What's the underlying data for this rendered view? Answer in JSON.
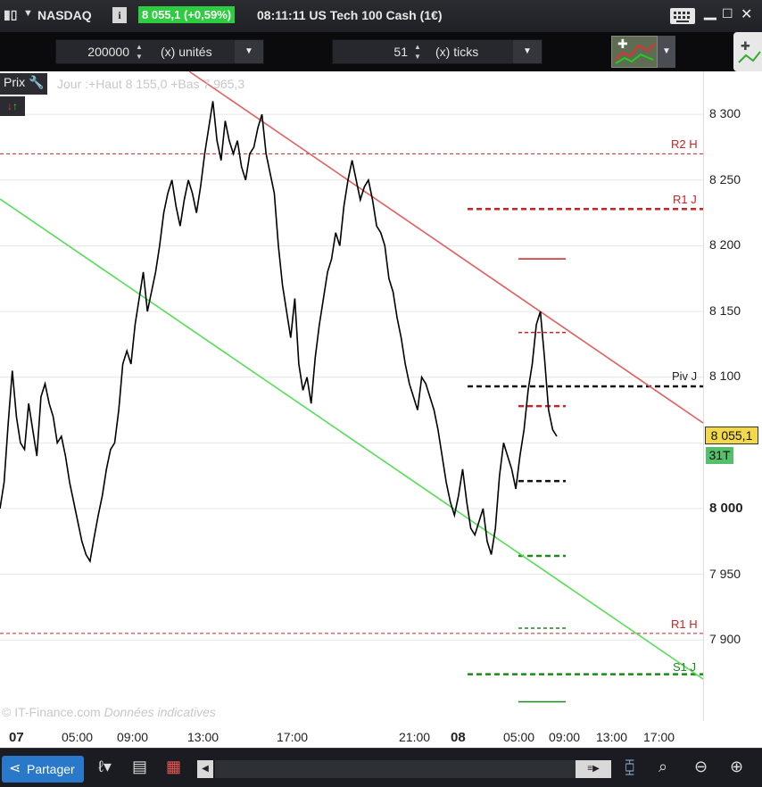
{
  "titlebar": {
    "symbol": "NASDAQ",
    "info_icon_label": "i",
    "quote": "8 055,1 (+0,59%)",
    "time_instrument": "08:11:11 US Tech 100 Cash (1€)",
    "icons": [
      "candlestick-icon",
      "chevron-down-icon",
      "keyboard-icon",
      "minimize-icon",
      "maximize-icon",
      "close-icon"
    ]
  },
  "toolbar": {
    "quantity_value": "200000",
    "quantity_unit": "(x) unités",
    "ticks_value": "51",
    "ticks_unit": "(x) ticks"
  },
  "legend": {
    "price_label": "Prix",
    "arrows": "↓↑",
    "day_text": "Jour :+Haut 8 155,0 +Bas 7 965,3"
  },
  "credit": {
    "source": "© IT-Finance.com",
    "note": "Données indicatives"
  },
  "price_badge": "8 055,1",
  "countdown_badge": "31T",
  "levels": {
    "r2h": "R2 H",
    "r1j": "R1 J",
    "pivj": "Piv J",
    "r1h": "R1 H",
    "s1j": "S1 J"
  },
  "bottombar": {
    "share_label": "Partager"
  },
  "colors": {
    "price_up": "#2ecc40",
    "resistance": "#cc2222",
    "support": "#1a8a1a",
    "channel_upper": "#e06060",
    "channel_lower": "#55dd55"
  },
  "chart_data": {
    "type": "line",
    "title": "US Tech 100 Cash (1€)",
    "series": [
      {
        "values": [
          8000,
          8020,
          8065,
          8105,
          8070,
          8050,
          8045,
          8080,
          8060,
          8040,
          8085,
          8095,
          8080,
          8070,
          8050,
          8055,
          8040,
          8020,
          8005,
          7990,
          7975,
          7965,
          7960,
          7978,
          7995,
          8010,
          8030,
          8045,
          8050,
          8075,
          8110,
          8120,
          8110,
          8140,
          8160,
          8180,
          8150,
          8165,
          8180,
          8200,
          8225,
          8240,
          8250,
          8230,
          8215,
          8235,
          8250,
          8240,
          8225,
          8245,
          8270,
          8290,
          8310,
          8280,
          8265,
          8295,
          8280,
          8270,
          8280,
          8260,
          8250,
          8270,
          8275,
          8290,
          8300,
          8270,
          8255,
          8240,
          8200,
          8170,
          8150,
          8130,
          8160,
          8110,
          8090,
          8100,
          8080,
          8115,
          8140,
          8160,
          8180,
          8190,
          8210,
          8200,
          8230,
          8250,
          8265,
          8250,
          8235,
          8245,
          8250,
          8235,
          8215,
          8210,
          8200,
          8175,
          8165,
          8145,
          8130,
          8110,
          8095,
          8085,
          8075,
          8100,
          8095,
          8085,
          8075,
          8060,
          8040,
          8020,
          8005,
          7995,
          8010,
          8030,
          8005,
          7985,
          7980,
          7990,
          8000,
          7975,
          7965,
          7985,
          8025,
          8050,
          8040,
          8030,
          8015,
          8040,
          8060,
          8090,
          8110,
          8140,
          8150,
          8115,
          8075,
          8060,
          8055
        ],
        "x_range": [
          "07 02:00",
          "08 08:11"
        ]
      }
    ],
    "lines": [
      {
        "name": "channel-upper",
        "from": {
          "x": "07 12:30",
          "y": 8335
        },
        "to": {
          "x": "08 23:00",
          "y": 8059
        }
      },
      {
        "name": "channel-lower",
        "from": {
          "x": "07 01:30",
          "y": 8237
        },
        "to": {
          "x": "08 23:00",
          "y": 7873
        }
      }
    ],
    "levels": [
      {
        "label": "R2 H",
        "value": 8270
      },
      {
        "label": "R1 J",
        "value": 8228
      },
      {
        "label": "Piv J",
        "value": 8093
      },
      {
        "label": "R1 H",
        "value": 7905
      },
      {
        "label": "S1 J",
        "value": 7874
      }
    ],
    "yticks": [
      "8 300",
      "8 250",
      "8 200",
      "8 150",
      "8 100",
      "8 000",
      "7 950",
      "7 900"
    ],
    "xticks": [
      "07",
      "05:00",
      "09:00",
      "13:00",
      "17:00",
      "21:00",
      "08",
      "05:00",
      "09:00",
      "13:00",
      "17:00"
    ],
    "ylim": [
      7860,
      8335
    ],
    "grid": true
  }
}
